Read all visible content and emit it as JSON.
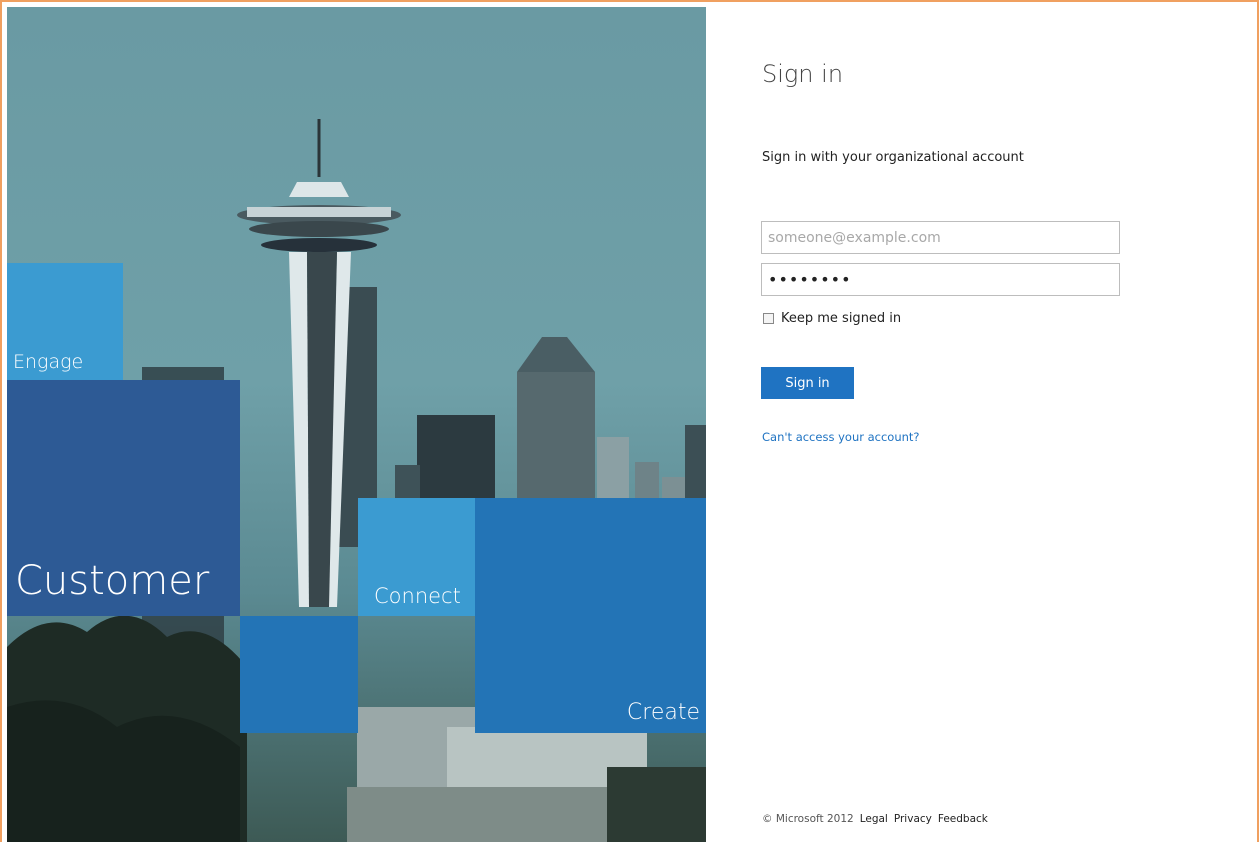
{
  "illustration": {
    "tiles": {
      "engage": "Engage",
      "customer": "Customer",
      "connect": "Connect",
      "create": "Create"
    },
    "colors": {
      "light_blue": "#3b9bd1",
      "dark_blue": "#2d5a95",
      "mid_blue": "#2374b6",
      "sky": "#6a9aa3"
    }
  },
  "signin": {
    "title": "Sign in",
    "subtitle": "Sign in with your organizational account",
    "email_placeholder": "someone@example.com",
    "email_value": "",
    "password_value": "••••••••",
    "keep_signed_in_label": "Keep me signed in",
    "keep_signed_in_checked": false,
    "button_label": "Sign in",
    "cant_access_link": "Can't access your account?",
    "accent_color": "#1f73c2"
  },
  "footer": {
    "copyright": "© Microsoft 2012",
    "links": [
      "Legal",
      "Privacy",
      "Feedback"
    ]
  }
}
